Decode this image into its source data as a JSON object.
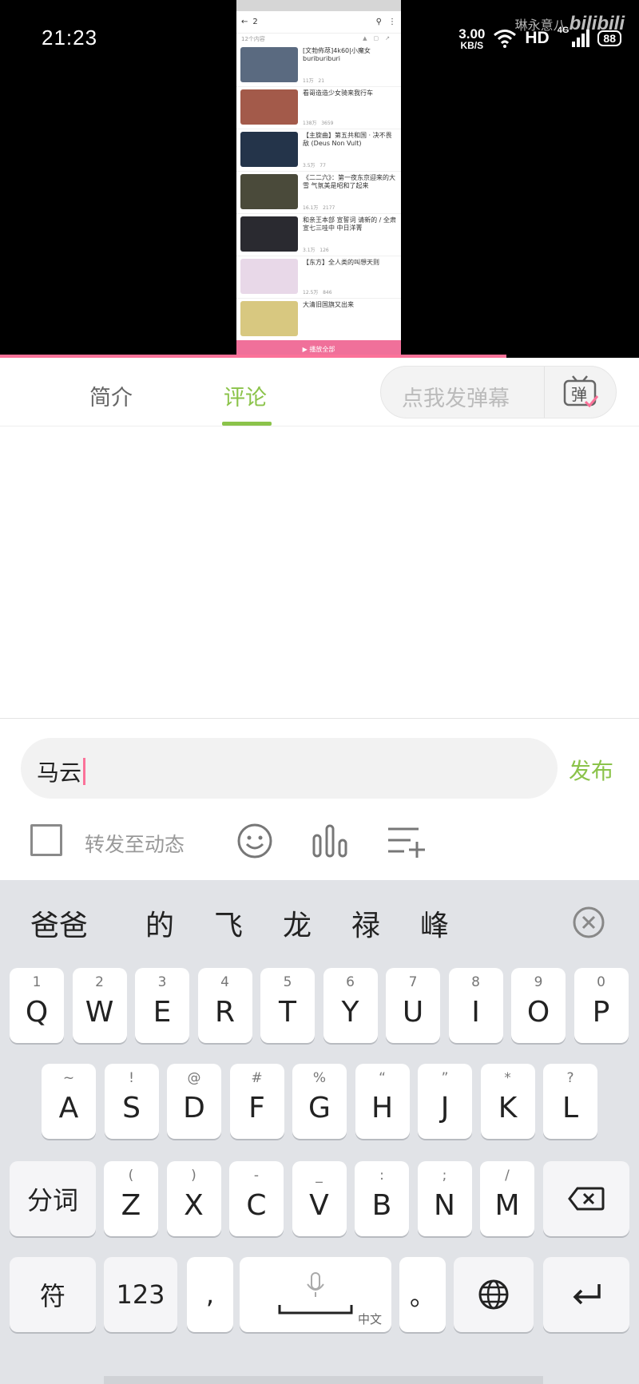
{
  "status_bar": {
    "time": "21:23",
    "net_speed_value": "3.00",
    "net_speed_unit": "KB/S",
    "hd_label": "HD",
    "signal_label": "4G",
    "battery_level": "88"
  },
  "watermark": {
    "user": "琳永意八",
    "brand": "bilibili"
  },
  "inner_video": {
    "search_text": "2",
    "subtitle": "12个内容",
    "videos": [
      {
        "title": "[文勃佈荩]4k60|小魔女buriburiburi",
        "meta": "11万",
        "meta2": "21"
      },
      {
        "title": "看哥造造少女骑来我行车",
        "meta": "138万",
        "meta2": "3659"
      },
      {
        "title": "【主旋曲】第五共和国 · 决不畏敌 (Deus Non Vult)",
        "meta": "3.5万",
        "meta2": "77"
      },
      {
        "title": "《二二六》：第一夜东京迎来的大雪 气氛美是昭和了起来",
        "meta": "16.1万",
        "meta2": "2177"
      },
      {
        "title": "和亲王本部 宣誓词 请新的 / 全肃宣七三哇中 中日洋菁",
        "meta": "3.1万",
        "meta2": "126"
      },
      {
        "title": "【东方】全人类的叫想天则",
        "meta": "12.5万",
        "meta2": "846"
      },
      {
        "title": "大清旧国旗又出来",
        "meta": "",
        "meta2": ""
      }
    ],
    "bottom_bar": "播放全部"
  },
  "tabs": {
    "intro": "简介",
    "comments": "评论"
  },
  "danmaku": {
    "placeholder": "点我发弹幕",
    "button_label": "弹"
  },
  "comment": {
    "input_value": "马云",
    "publish_label": "发布",
    "repost_label": "转发至动态"
  },
  "keyboard": {
    "candidates": [
      "爸爸",
      "的",
      "飞",
      "龙",
      "禄",
      "峰"
    ],
    "row1": [
      {
        "k": "Q",
        "h": "1"
      },
      {
        "k": "W",
        "h": "2"
      },
      {
        "k": "E",
        "h": "3"
      },
      {
        "k": "R",
        "h": "4"
      },
      {
        "k": "T",
        "h": "5"
      },
      {
        "k": "Y",
        "h": "6"
      },
      {
        "k": "U",
        "h": "7"
      },
      {
        "k": "I",
        "h": "8"
      },
      {
        "k": "O",
        "h": "9"
      },
      {
        "k": "P",
        "h": "0"
      }
    ],
    "row2": [
      {
        "k": "A",
        "h": "~"
      },
      {
        "k": "S",
        "h": "!"
      },
      {
        "k": "D",
        "h": "@"
      },
      {
        "k": "F",
        "h": "#"
      },
      {
        "k": "G",
        "h": "%"
      },
      {
        "k": "H",
        "h": "“"
      },
      {
        "k": "J",
        "h": "”"
      },
      {
        "k": "K",
        "h": "*"
      },
      {
        "k": "L",
        "h": "?"
      }
    ],
    "row3": [
      {
        "k": "Z",
        "h": "("
      },
      {
        "k": "X",
        "h": ")"
      },
      {
        "k": "C",
        "h": "-"
      },
      {
        "k": "V",
        "h": "_"
      },
      {
        "k": "B",
        "h": ":"
      },
      {
        "k": "N",
        "h": ";"
      },
      {
        "k": "M",
        "h": "/"
      }
    ],
    "segment_label": "分词",
    "symbol_label": "符",
    "numbers_label": "123",
    "comma_label": ",",
    "space_sub_label": "中文",
    "period_label": "。"
  },
  "colors": {
    "accent_green": "#8bc34a",
    "bili_pink": "#fb7299"
  }
}
